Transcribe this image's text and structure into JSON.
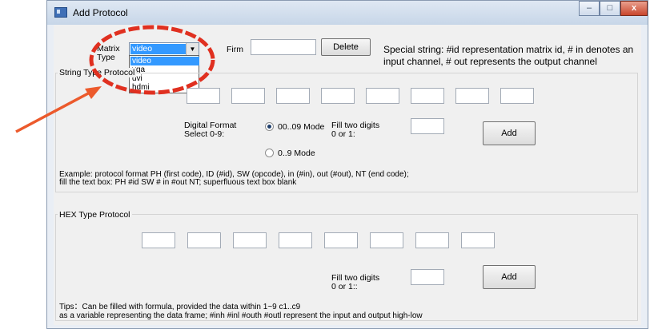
{
  "window": {
    "title": "Add Protocol",
    "buttons": {
      "minimize": "–",
      "maximize": "□",
      "close": "x"
    }
  },
  "top": {
    "matrix_type_label_line1": "Matrix",
    "matrix_type_label_line2": "Type",
    "combo_value": "video",
    "dropdown_options": [
      "video",
      "vga",
      "dvi",
      "hdmi"
    ],
    "firm_label": "Firm",
    "firm_value": "",
    "delete_label": "Delete",
    "special_line1": "Special string: #id representation matrix id, # in denotes an",
    "special_line2": "input channel, # out represents the output channel"
  },
  "string_group": {
    "title": "String Type Protocol",
    "digital_format_label_line1": "Digital Format",
    "digital_format_label_line2": "Select 0-9:",
    "mode1_label": "00..09 Mode",
    "mode2_label": "0..9 Mode",
    "fill_label_line1": "Fill two digits",
    "fill_label_line2": "0 or 1:",
    "add_label": "Add",
    "example_line1": "Example: protocol format PH (first code), ID (#id), SW (opcode), in (#in), out (#out), NT (end code);",
    "example_line2": "fill the text box: PH #id SW # in #out NT; superfluous text box blank"
  },
  "hex_group": {
    "title": "HEX Type Protocol",
    "fill_label_line1": "Fill two digits",
    "fill_label_line2": "0 or 1::",
    "add_label": "Add",
    "tips_line1": "Tips：Can be filled with formula, provided the data within 1~9 c1..c9",
    "tips_line2": "as a variable representing the data frame; #inh #inl #outh #outl represent the input and output high-low"
  },
  "annotation": {
    "color": "#e03020"
  }
}
